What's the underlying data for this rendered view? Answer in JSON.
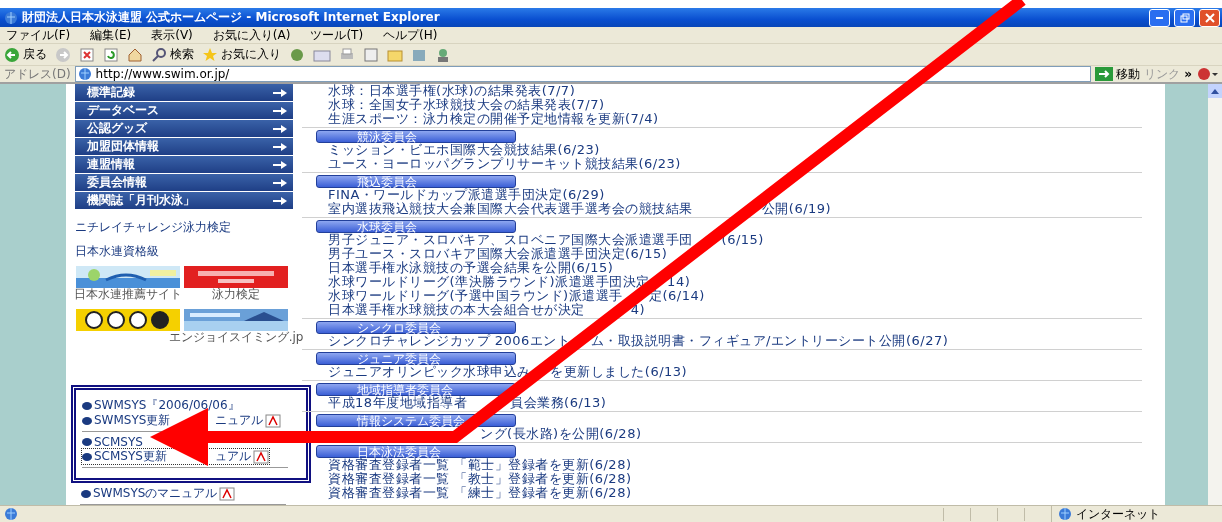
{
  "window": {
    "title": "財団法人日本水泳連盟 公式ホームページ - Microsoft Internet Explorer"
  },
  "menu": [
    "ファイル(F)",
    "編集(E)",
    "表示(V)",
    "お気に入り(A)",
    "ツール(T)",
    "ヘルプ(H)"
  ],
  "toolbar": {
    "back": "戻る",
    "search": "検索",
    "favorites": "お気に入り"
  },
  "address": {
    "label": "アドレス(D)",
    "url": "http://www.swim.or.jp/",
    "go": "移動",
    "links": "リンク",
    "more": "»"
  },
  "nav": [
    "標準記録",
    "データベース",
    "公認グッズ",
    "加盟団体情報",
    "連盟情報",
    "委員会情報",
    "機関誌「月刊水泳」"
  ],
  "side_links": [
    "ニチレイチャレンジ泳力検定",
    "日本水連資格級"
  ],
  "banner_rows": [
    {
      "items": [
        {
          "kind": "swim",
          "caption": "日本水連推薦サイト"
        },
        {
          "kind": "nichirei",
          "caption": "泳力検定"
        }
      ]
    },
    {
      "items": [
        {
          "kind": "toto"
        },
        {
          "kind": "enjoy",
          "caption": "エンジョイスイミング.jp"
        }
      ]
    }
  ],
  "system_groups": [
    [
      {
        "parts": [
          "SWMSYS『2006/06/06』"
        ],
        "pdf": false,
        "focused": false
      },
      {
        "parts": [
          "SWMSYS更新",
          "ニュアル"
        ],
        "pdf": true,
        "focused": false
      }
    ],
    [
      {
        "parts": [
          "SCMSYS"
        ],
        "pdf": false,
        "focused": false
      },
      {
        "parts": [
          "SCMSYS更新",
          "ュアル"
        ],
        "pdf": true,
        "focused": true
      }
    ]
  ],
  "more_system_links": [
    {
      "parts": [
        "SWMSYSのマニュアル"
      ],
      "pdf": true
    }
  ],
  "news": {
    "top_items": [
      "水球：日本選手権(水球)の結果発表(7/7)",
      "水球：全国女子水球競技大会の結果発表(7/7)",
      "生涯スポーツ：泳力検定の開催予定地情報を更新(7/4)"
    ],
    "sections": [
      {
        "title": "競泳委員会",
        "items": [
          {
            "parts": [
              "ミッション・ビエホ国際大会競技結果(6/23)"
            ]
          },
          {
            "parts": [
              "ユース・ヨーロッパグランプリサーキット競技結果(6/23)"
            ]
          }
        ]
      },
      {
        "title": "飛込委員会",
        "items": [
          {
            "parts": [
              "FINA・ワールドカップ派遣選手団決定(6/29)"
            ]
          },
          {
            "parts": [
              "室内選抜飛込競技大会兼国際大会代表選手選考会の競技結果",
              "公開(6/19)"
            ]
          }
        ]
      },
      {
        "title": "水球委員会",
        "items": [
          {
            "parts": [
              "男子ジュニア・スロバキア、スロベニア国際大会派遣選手団",
              "(6/15)"
            ]
          },
          {
            "parts": [
              "男子ユース・スロバキア国際大会派遣選手団決定(6/15)"
            ]
          },
          {
            "parts": [
              "日本選手権水泳競技の予選会結果を公開(6/15)"
            ]
          },
          {
            "parts": [
              "水球ワールドリーグ(準決勝ラウンド)派遣選手団決定",
              "14)"
            ]
          },
          {
            "parts": [
              "水球ワールドリーグ(予選中国ラウンド)派遣選手",
              "定(6/14)"
            ]
          },
          {
            "parts": [
              "日本選手権水球競技の本大会組合せが決定",
              "4)"
            ]
          }
        ]
      },
      {
        "title": "シンクロ委員会",
        "items": [
          {
            "parts": [
              "シンクロチャレンジカップ 2006エント",
              "ム・取扱説明書・フィギュア/エントリーシート公開(6/27)"
            ]
          }
        ]
      },
      {
        "title": "ジュニア委員会",
        "items": [
          {
            "parts": [
              "ジュニアオリンピック水球申込み",
              "を更新しました(6/13)"
            ]
          }
        ]
      },
      {
        "title": "地域指導者委員会",
        "items": [
          {
            "parts": [
              "平成18年度地域指導者",
              "員会業務(6/13)"
            ]
          }
        ]
      },
      {
        "title": "情報システム委員会",
        "items": [
          {
            "parts": [
              "ング(長水路)を公開(6/28)"
            ],
            "covered": true
          }
        ]
      },
      {
        "title": "日本泳法委員会",
        "items": [
          {
            "parts": [
              "資格審査登録者一覧 「範士」登録者を更新(6/28)"
            ]
          },
          {
            "parts": [
              "資格審査登録者一覧 「教士」登録者を更新(6/28)"
            ]
          },
          {
            "parts": [
              "資格審査登録者一覧 「練士」登録者を更新(6/28)"
            ]
          }
        ]
      }
    ]
  },
  "status_bar": {
    "zone": "インターネット"
  }
}
